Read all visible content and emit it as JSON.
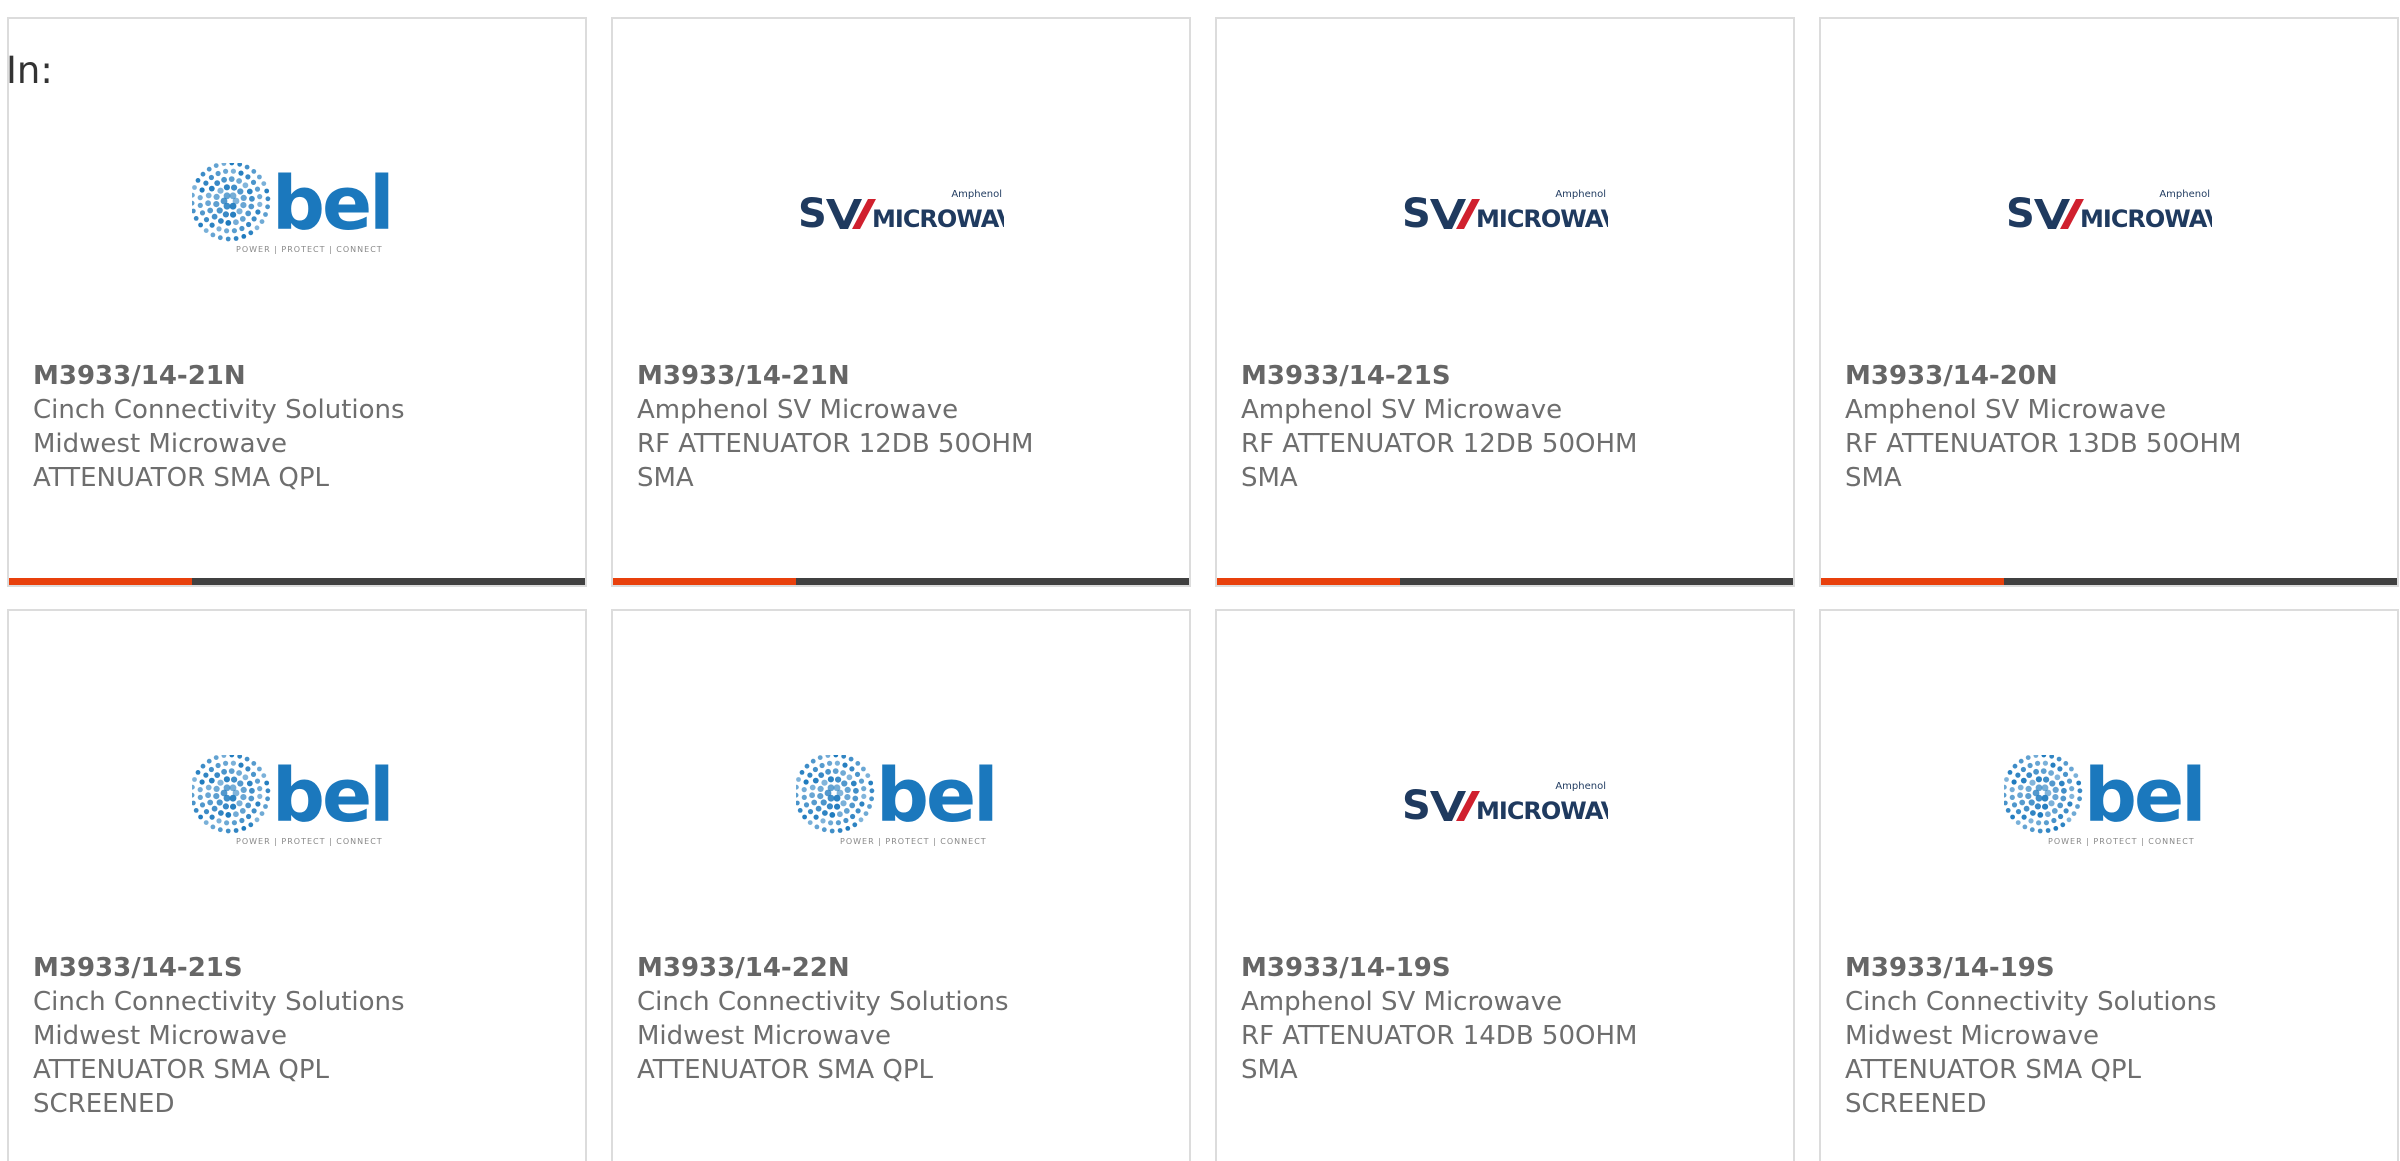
{
  "filter": {
    "label": "In:"
  },
  "colors": {
    "accent": "#e8400c",
    "bar": "#404040",
    "bel_blue": "#1b78bd",
    "sv_navy": "#1f3a5f",
    "sv_red": "#d0202e"
  },
  "products": [
    {
      "part": "M3933/14-21N",
      "lines": [
        "Cinch Connectivity Solutions",
        "Midwest Microwave",
        "ATTENUATOR SMA QPL"
      ],
      "logo": "bel"
    },
    {
      "part": "M3933/14-21N",
      "lines": [
        "Amphenol SV Microwave",
        "RF ATTENUATOR 12DB 50OHM",
        "SMA"
      ],
      "logo": "sv"
    },
    {
      "part": "M3933/14-21S",
      "lines": [
        "Amphenol SV Microwave",
        "RF ATTENUATOR 12DB 50OHM",
        "SMA"
      ],
      "logo": "sv"
    },
    {
      "part": "M3933/14-20N",
      "lines": [
        "Amphenol SV Microwave",
        "RF ATTENUATOR 13DB 50OHM",
        "SMA"
      ],
      "logo": "sv"
    },
    {
      "part": "M3933/14-21S",
      "lines": [
        "Cinch Connectivity Solutions",
        "Midwest Microwave",
        "ATTENUATOR SMA QPL",
        "SCREENED"
      ],
      "logo": "bel"
    },
    {
      "part": "M3933/14-22N",
      "lines": [
        "Cinch Connectivity Solutions",
        "Midwest Microwave",
        "ATTENUATOR SMA QPL"
      ],
      "logo": "bel"
    },
    {
      "part": "M3933/14-19S",
      "lines": [
        "Amphenol SV Microwave",
        "RF ATTENUATOR 14DB 50OHM",
        "SMA"
      ],
      "logo": "sv"
    },
    {
      "part": "M3933/14-19S",
      "lines": [
        "Cinch Connectivity Solutions",
        "Midwest Microwave",
        "ATTENUATOR SMA QPL",
        "SCREENED"
      ],
      "logo": "bel"
    }
  ],
  "logos": {
    "bel": {
      "icon": "bel-logo-icon",
      "wordmark": "bel",
      "tagline": "POWER | PROTECT | CONNECT"
    },
    "sv": {
      "icon": "sv-microwave-logo-icon",
      "wordmark": "MICROWAVE",
      "brand": "Amphenol"
    }
  }
}
